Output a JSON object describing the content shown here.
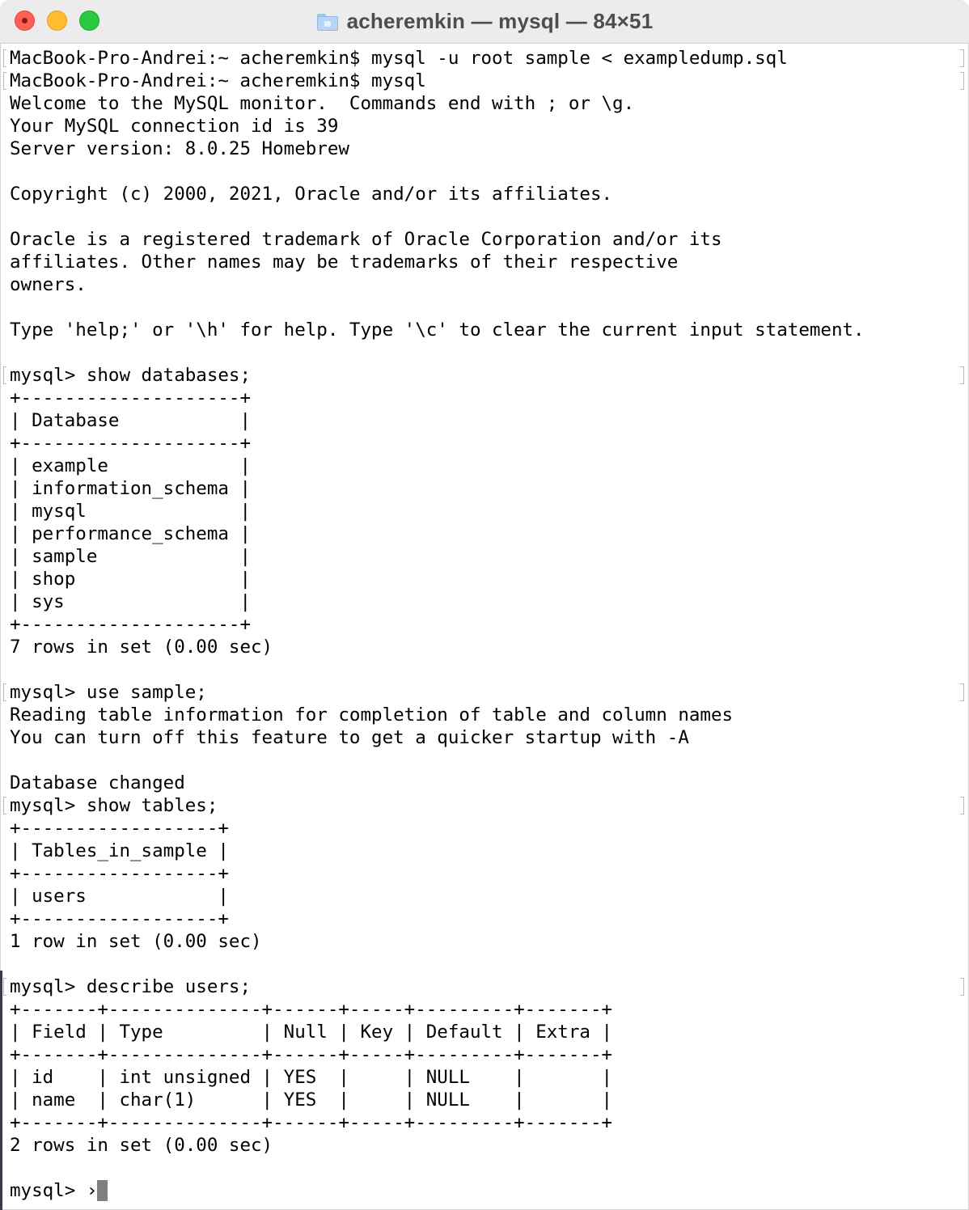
{
  "window": {
    "title": "acheremkin — mysql — 84×51"
  },
  "terminal": {
    "lines": [
      {
        "text": "MacBook-Pro-Andrei:~ acheremkin$ mysql -u root sample < exampledump.sql",
        "mark": true
      },
      {
        "text": "MacBook-Pro-Andrei:~ acheremkin$ mysql",
        "mark": true
      },
      {
        "text": "Welcome to the MySQL monitor.  Commands end with ; or \\g.",
        "mark": false
      },
      {
        "text": "Your MySQL connection id is 39",
        "mark": false
      },
      {
        "text": "Server version: 8.0.25 Homebrew",
        "mark": false
      },
      {
        "text": "",
        "mark": false
      },
      {
        "text": "Copyright (c) 2000, 2021, Oracle and/or its affiliates.",
        "mark": false
      },
      {
        "text": "",
        "mark": false
      },
      {
        "text": "Oracle is a registered trademark of Oracle Corporation and/or its",
        "mark": false
      },
      {
        "text": "affiliates. Other names may be trademarks of their respective",
        "mark": false
      },
      {
        "text": "owners.",
        "mark": false
      },
      {
        "text": "",
        "mark": false
      },
      {
        "text": "Type 'help;' or '\\h' for help. Type '\\c' to clear the current input statement.",
        "mark": false
      },
      {
        "text": "",
        "mark": false
      },
      {
        "text": "mysql> show databases;",
        "mark": true
      },
      {
        "text": "+--------------------+",
        "mark": false
      },
      {
        "text": "| Database           |",
        "mark": false
      },
      {
        "text": "+--------------------+",
        "mark": false
      },
      {
        "text": "| example            |",
        "mark": false
      },
      {
        "text": "| information_schema |",
        "mark": false
      },
      {
        "text": "| mysql              |",
        "mark": false
      },
      {
        "text": "| performance_schema |",
        "mark": false
      },
      {
        "text": "| sample             |",
        "mark": false
      },
      {
        "text": "| shop               |",
        "mark": false
      },
      {
        "text": "| sys                |",
        "mark": false
      },
      {
        "text": "+--------------------+",
        "mark": false
      },
      {
        "text": "7 rows in set (0.00 sec)",
        "mark": false
      },
      {
        "text": "",
        "mark": false
      },
      {
        "text": "mysql> use sample;",
        "mark": true
      },
      {
        "text": "Reading table information for completion of table and column names",
        "mark": false
      },
      {
        "text": "You can turn off this feature to get a quicker startup with -A",
        "mark": false
      },
      {
        "text": "",
        "mark": false
      },
      {
        "text": "Database changed",
        "mark": false
      },
      {
        "text": "mysql> show tables;",
        "mark": true
      },
      {
        "text": "+------------------+",
        "mark": false
      },
      {
        "text": "| Tables_in_sample |",
        "mark": false
      },
      {
        "text": "+------------------+",
        "mark": false
      },
      {
        "text": "| users            |",
        "mark": false
      },
      {
        "text": "+------------------+",
        "mark": false
      },
      {
        "text": "1 row in set (0.00 sec)",
        "mark": false
      },
      {
        "text": "",
        "mark": false
      },
      {
        "text": "mysql> describe users;",
        "mark": true
      },
      {
        "text": "+-------+--------------+------+-----+---------+-------+",
        "mark": false
      },
      {
        "text": "| Field | Type         | Null | Key | Default | Extra |",
        "mark": false
      },
      {
        "text": "+-------+--------------+------+-----+---------+-------+",
        "mark": false
      },
      {
        "text": "| id    | int unsigned | YES  |     | NULL    |       |",
        "mark": false
      },
      {
        "text": "| name  | char(1)      | YES  |     | NULL    |       |",
        "mark": false
      },
      {
        "text": "+-------+--------------+------+-----+---------+-------+",
        "mark": false
      },
      {
        "text": "2 rows in set (0.00 sec)",
        "mark": false
      },
      {
        "text": "",
        "mark": false
      }
    ],
    "prompt": "mysql> ›"
  }
}
